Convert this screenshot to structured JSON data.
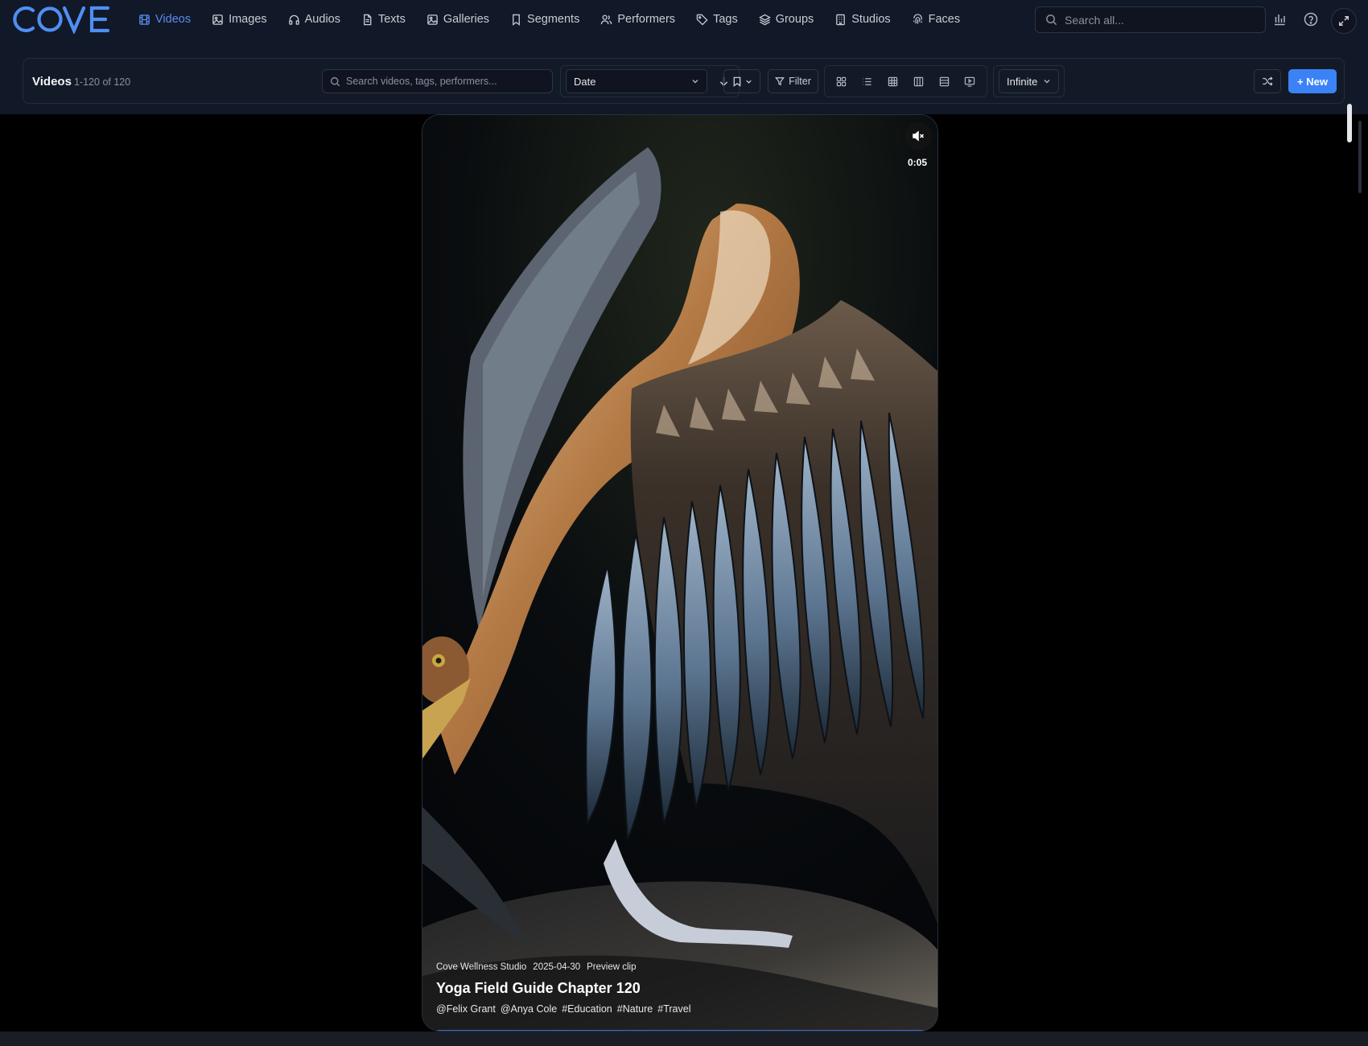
{
  "app": {
    "logo_text": "COVE"
  },
  "nav": {
    "items": [
      {
        "label": "Videos",
        "icon": "film-icon",
        "active": true
      },
      {
        "label": "Images",
        "icon": "image-icon",
        "active": false
      },
      {
        "label": "Audios",
        "icon": "headphones-icon",
        "active": false
      },
      {
        "label": "Texts",
        "icon": "file-text-icon",
        "active": false
      },
      {
        "label": "Galleries",
        "icon": "gallery-icon",
        "active": false
      },
      {
        "label": "Segments",
        "icon": "bookmark-icon",
        "active": false
      },
      {
        "label": "Performers",
        "icon": "users-icon",
        "active": false
      },
      {
        "label": "Tags",
        "icon": "tag-icon",
        "active": false
      },
      {
        "label": "Groups",
        "icon": "layers-icon",
        "active": false
      },
      {
        "label": "Studios",
        "icon": "building-icon",
        "active": false
      },
      {
        "label": "Faces",
        "icon": "fingerprint-icon",
        "active": false
      }
    ],
    "search_placeholder": "Search all..."
  },
  "toolbar": {
    "title": "Videos",
    "count": "1-120 of 120",
    "search_placeholder": "Search videos, tags, performers...",
    "sort_value": "Date",
    "sort_direction": "descending",
    "filter_label": "Filter",
    "pagination_value": "Infinite",
    "new_label": "+ New"
  },
  "video": {
    "timestamp": "0:05",
    "muted": true,
    "studio": "Cove Wellness Studio",
    "date": "2025-04-30",
    "kind": "Preview clip",
    "title": "Yoga Field Guide Chapter 120",
    "performers": [
      "@Felix Grant",
      "@Anya Cole"
    ],
    "tags": [
      "#Education",
      "#Nature",
      "#Travel"
    ]
  },
  "colors": {
    "accent": "#3b82f6",
    "active_nav": "#5b8def",
    "nav_bg": "#111827",
    "page_bg": "#000000"
  }
}
